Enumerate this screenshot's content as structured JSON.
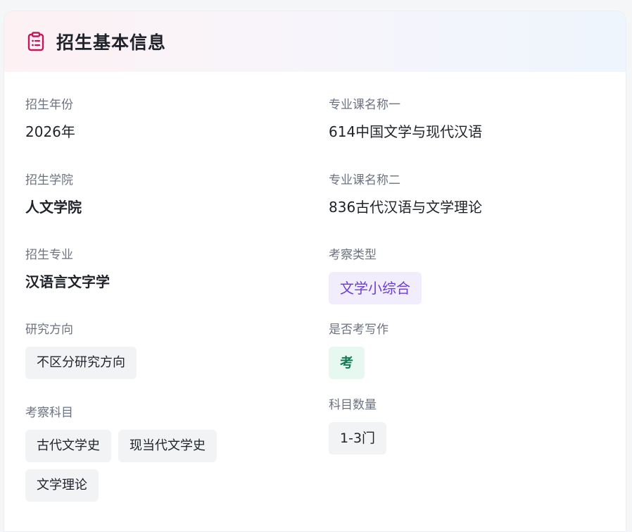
{
  "header": {
    "title": "招生基本信息",
    "icon": "clipboard-icon",
    "accent_color": "#c2185b"
  },
  "left_fields": {
    "year": {
      "label": "招生年份",
      "value": "2026年"
    },
    "college": {
      "label": "招生学院",
      "value": "人文学院"
    },
    "major": {
      "label": "招生专业",
      "value": "汉语言文字学"
    },
    "direction": {
      "label": "研究方向",
      "chips": [
        "不区分研究方向"
      ]
    },
    "subjects": {
      "label": "考察科目",
      "chips": [
        "古代文学史",
        "现当代文学史",
        "文学理论"
      ]
    }
  },
  "right_fields": {
    "course1": {
      "label": "专业课名称一",
      "value": "614中国文学与现代汉语"
    },
    "course2": {
      "label": "专业课名称二",
      "value": "836古代汉语与文学理论"
    },
    "exam_type": {
      "label": "考察类型",
      "chip": "文学小综合",
      "color": "#6d3fd4"
    },
    "writing": {
      "label": "是否考写作",
      "chip": "考",
      "color": "#137a54"
    },
    "count": {
      "label": "科目数量",
      "chip": "1-3门"
    }
  }
}
